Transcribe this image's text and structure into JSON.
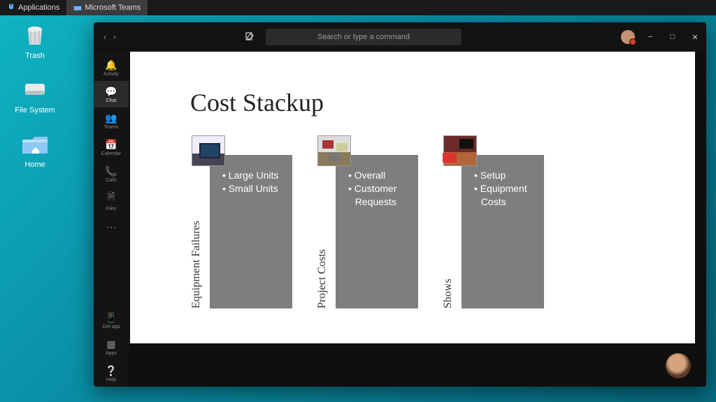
{
  "taskbar": {
    "applications_label": "Applications",
    "active_app_label": "Microsoft Teams"
  },
  "desktop": {
    "icons": [
      {
        "label": "Trash"
      },
      {
        "label": "File System"
      },
      {
        "label": "Home"
      }
    ]
  },
  "teams": {
    "search_placeholder": "Search or type a command",
    "sidebar": {
      "items": [
        {
          "label": "Activity"
        },
        {
          "label": "Chat"
        },
        {
          "label": "Teams"
        },
        {
          "label": "Calendar"
        },
        {
          "label": "Calls"
        },
        {
          "label": "Files"
        }
      ],
      "bottom": [
        {
          "label": "Get app"
        },
        {
          "label": "Apps"
        },
        {
          "label": "Help"
        }
      ]
    }
  },
  "slide": {
    "title": "Cost Stackup",
    "pillars": [
      {
        "heading": "Equipment Failures",
        "bullets": [
          "Large Units",
          "Small Units"
        ]
      },
      {
        "heading": "Project Costs",
        "bullets": [
          "Overall",
          "Customer Requests"
        ]
      },
      {
        "heading": "Shows",
        "bullets": [
          "Setup",
          "Equipment Costs"
        ]
      }
    ]
  }
}
